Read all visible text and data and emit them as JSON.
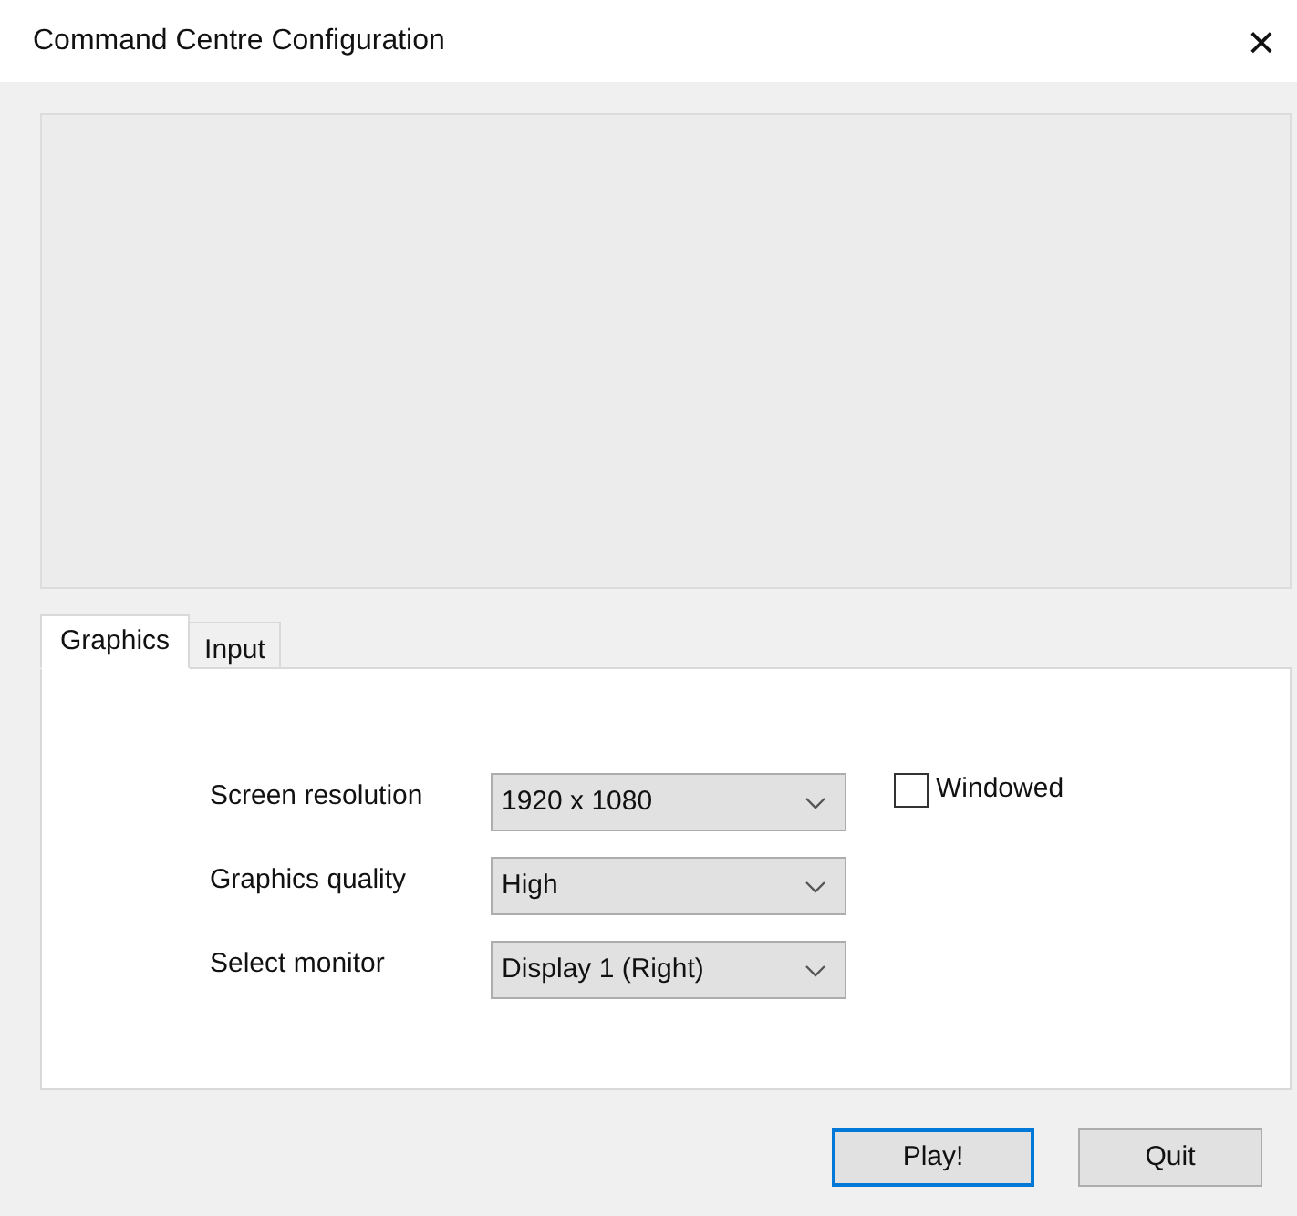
{
  "window": {
    "title": "Command Centre Configuration",
    "close": "×"
  },
  "tabs": [
    {
      "label": "Graphics",
      "selected": true
    },
    {
      "label": "Input",
      "selected": false
    }
  ],
  "settings": [
    {
      "label": "Screen resolution",
      "value": "1920 x 1080"
    },
    {
      "label": "Graphics quality",
      "value": "High"
    },
    {
      "label": "Select monitor",
      "value": "Display 1 (Right)"
    }
  ],
  "windowed": {
    "label": "Windowed",
    "checked": false
  },
  "buttons": [
    {
      "label": "Play!",
      "default": true
    },
    {
      "label": "Quit",
      "default": false
    }
  ]
}
